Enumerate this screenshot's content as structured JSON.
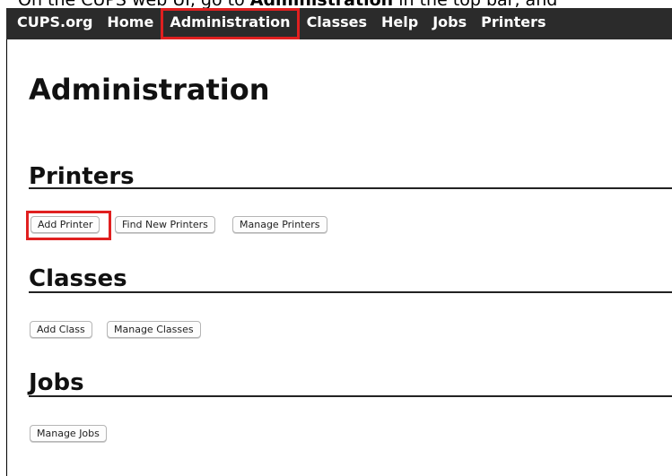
{
  "caption": {
    "prefix": "On the CUPS web UI, go to ",
    "emphasis": "Administration",
    "suffix": " in the top bar, and"
  },
  "nav": {
    "items": [
      "CUPS.org",
      "Home",
      "Administration",
      "Classes",
      "Help",
      "Jobs",
      "Printers"
    ],
    "highlighted": "Administration"
  },
  "page": {
    "title": "Administration"
  },
  "sections": {
    "printers": {
      "title": "Printers",
      "buttons": [
        "Add Printer",
        "Find New Printers",
        "Manage Printers"
      ],
      "highlighted_button": "Add Printer"
    },
    "classes": {
      "title": "Classes",
      "buttons": [
        "Add Class",
        "Manage Classes"
      ]
    },
    "jobs": {
      "title": "Jobs",
      "buttons": [
        "Manage Jobs"
      ]
    }
  },
  "colors": {
    "navbar": "#2b2b2b",
    "highlight": "#e02020"
  }
}
